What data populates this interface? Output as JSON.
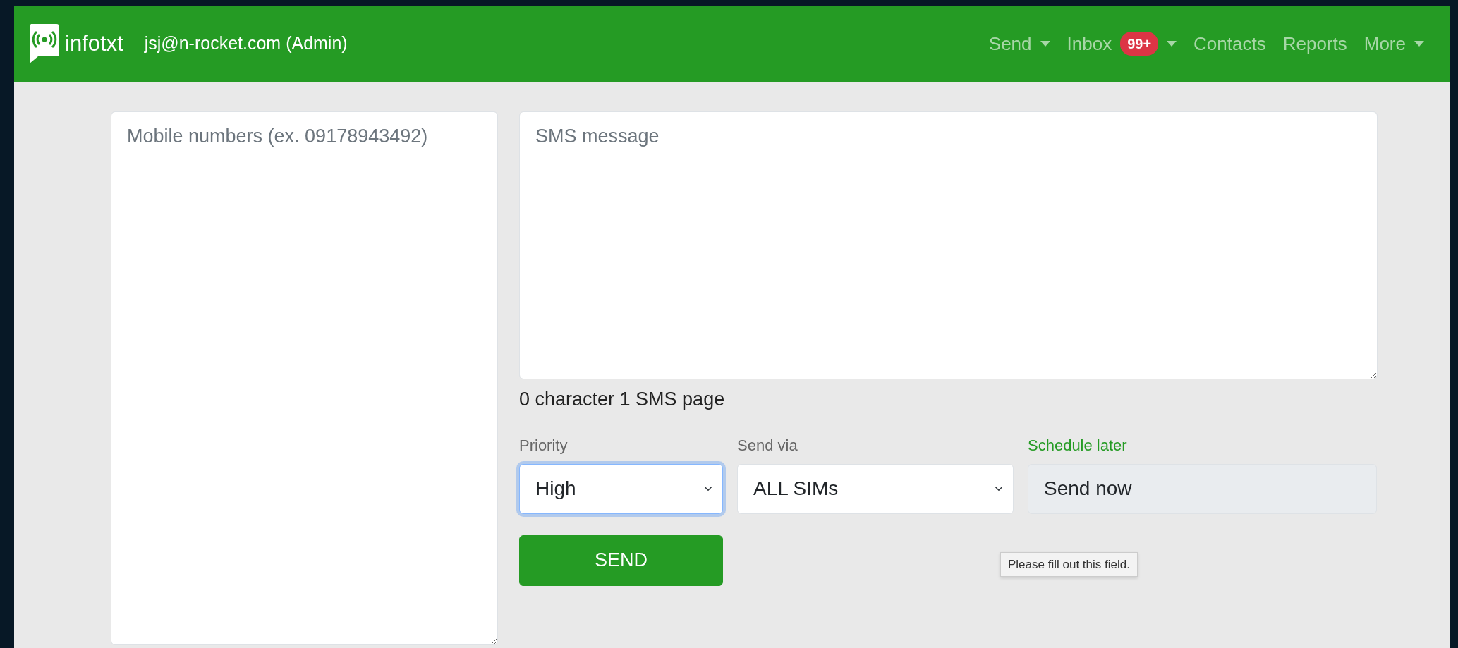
{
  "navbar": {
    "brand": "infotxt",
    "user": "jsj@n-rocket.com (Admin)",
    "items": [
      {
        "label": "Send",
        "dropdown": true
      },
      {
        "label": "Inbox",
        "badge": "99+",
        "dropdown": true
      },
      {
        "label": "Contacts",
        "dropdown": false
      },
      {
        "label": "Reports",
        "dropdown": false
      },
      {
        "label": "More",
        "dropdown": true
      }
    ]
  },
  "numbers_field": {
    "placeholder": "Mobile numbers (ex. 09178943492)"
  },
  "message_field": {
    "placeholder": "SMS message"
  },
  "counter": "0 character 1 SMS page",
  "options": [
    {
      "kind": "select",
      "label": "Priority",
      "value": "High",
      "focused": true
    },
    {
      "kind": "select",
      "label": "Send via",
      "value": "ALL SIMs",
      "focused": false
    },
    {
      "kind": "readonly",
      "label": "Schedule later",
      "value": "Send now",
      "focused": false
    }
  ],
  "send_button": "SEND",
  "tooltip": "Please fill out this field."
}
